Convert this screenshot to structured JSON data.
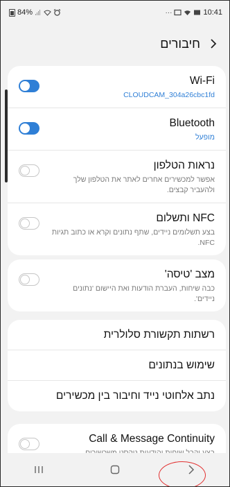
{
  "status_bar": {
    "battery": "84%",
    "dots": "···",
    "time": "10:41"
  },
  "header": {
    "title": "חיבורים",
    "back_icon": "chevron-right-icon"
  },
  "toggles_card": [
    {
      "title": "Wi-Fi",
      "subtitle": "CLOUDCAM_304a26cbc1fd",
      "state": "on"
    },
    {
      "title": "Bluetooth",
      "subtitle": "מופעל",
      "state": "on"
    },
    {
      "title": "נראות הטלפון",
      "subtitle": "אפשר למכשירים אחרים לאתר את הטלפון שלך ולהעביר קבצים.",
      "state": "off"
    },
    {
      "title": "NFC ותשלום",
      "subtitle": "בצע תשלומים ניידים, שתף נתונים וקרא או כתוב תגיות NFC.",
      "state": "off"
    }
  ],
  "airplane_card": {
    "title": "מצב 'טיסה'",
    "subtitle": "כבה שיחות, העברת הודעות ואת היישום 'נתונים ניידים'.",
    "state": "off"
  },
  "links_card": [
    "רשתות תקשורת סלולרית",
    "שימוש בנתונים",
    "נתב אלחוטי נייד וחיבור בין מכשירים"
  ],
  "continuity_card": {
    "title": "Call & Message Continuity",
    "subtitle": "בצע וקבל שיחות והודעות טקסט משכשירים",
    "state": "off"
  },
  "accent_color": "#2f7fd6",
  "annotation_color": "#e23030"
}
